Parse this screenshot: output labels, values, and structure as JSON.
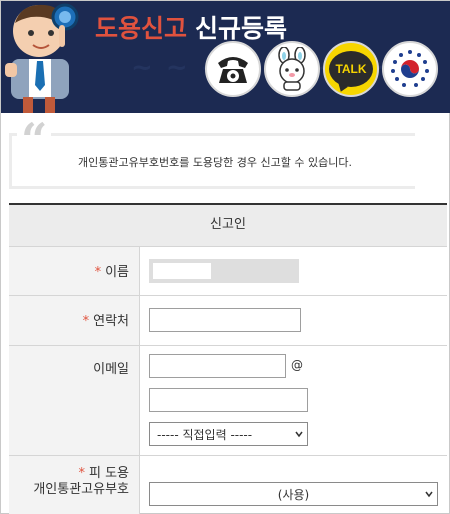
{
  "header": {
    "title_red": "도용신고",
    "title_white": "신규등록",
    "quick_buttons": [
      {
        "icon": "telephone-icon"
      },
      {
        "icon": "mascot-character-icon"
      },
      {
        "icon": "kakaotalk-icon",
        "label": "TALK"
      },
      {
        "icon": "government-emblem-icon"
      }
    ],
    "colors": {
      "banner": "#1c2a52",
      "accent_red": "#e0523e",
      "talk_yellow": "#f7d600"
    }
  },
  "notice": {
    "text": "개인통관고유부호번호를 도용당한 경우 신고할 수 있습니다."
  },
  "form": {
    "section_title": "신고인",
    "required_mark": "*",
    "name_label": "이름",
    "phone_label": "연락처",
    "email_label": "이메일",
    "email_at": "@",
    "email_domain_select": "----- 직접입력 -----",
    "victim_label_line1": "피 도용",
    "victim_label_line2": "개인통관고유부호",
    "victim_select": "(사용)"
  }
}
